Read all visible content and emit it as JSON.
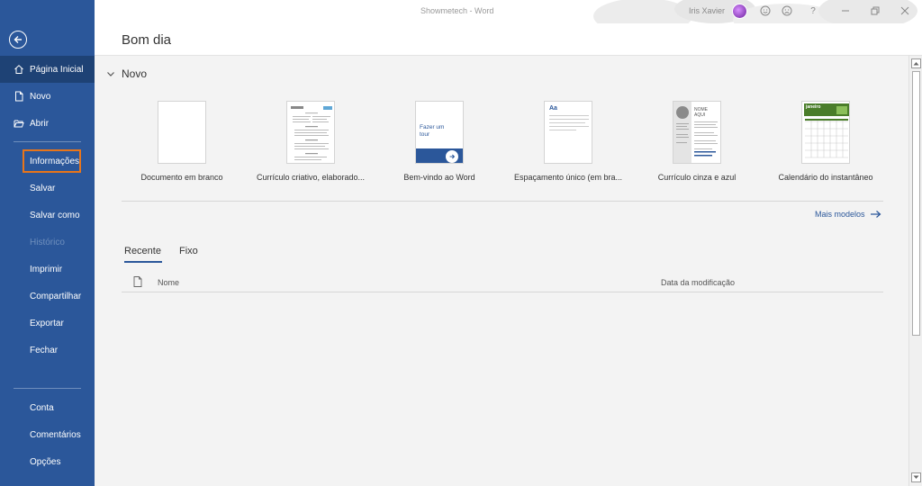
{
  "window": {
    "title": "Showmetech  -  Word",
    "user_name": "Iris Xavier"
  },
  "header": {
    "greeting": "Bom dia"
  },
  "sidebar": {
    "items": [
      {
        "label": "Página Inicial"
      },
      {
        "label": "Novo"
      },
      {
        "label": "Abrir"
      },
      {
        "label": "Informações"
      },
      {
        "label": "Salvar"
      },
      {
        "label": "Salvar como"
      },
      {
        "label": "Histórico"
      },
      {
        "label": "Imprimir"
      },
      {
        "label": "Compartilhar"
      },
      {
        "label": "Exportar"
      },
      {
        "label": "Fechar"
      },
      {
        "label": "Conta"
      },
      {
        "label": "Comentários"
      },
      {
        "label": "Opções"
      }
    ]
  },
  "new_section": {
    "title": "Novo",
    "templates": [
      {
        "name": "Documento em branco"
      },
      {
        "name": "Currículo criativo, elaborado..."
      },
      {
        "name": "Bem-vindo ao Word",
        "thumb_text": "Fazer um tour"
      },
      {
        "name": "Espaçamento único (em bra...",
        "thumb_text": "Aa"
      },
      {
        "name": "Currículo cinza e azul",
        "thumb_text": "NOME AQUI"
      },
      {
        "name": "Calendário do instantâneo",
        "thumb_text": "janeiro"
      }
    ],
    "more_label": "Mais modelos"
  },
  "tabs": [
    {
      "label": "Recente"
    },
    {
      "label": "Fixo"
    }
  ],
  "list": {
    "col_name": "Nome",
    "col_date": "Data da modificação"
  },
  "colors": {
    "sidebar": "#2b579a",
    "sidebar_active": "#1e4275",
    "highlight": "#e8751a",
    "link": "#2b579a"
  }
}
